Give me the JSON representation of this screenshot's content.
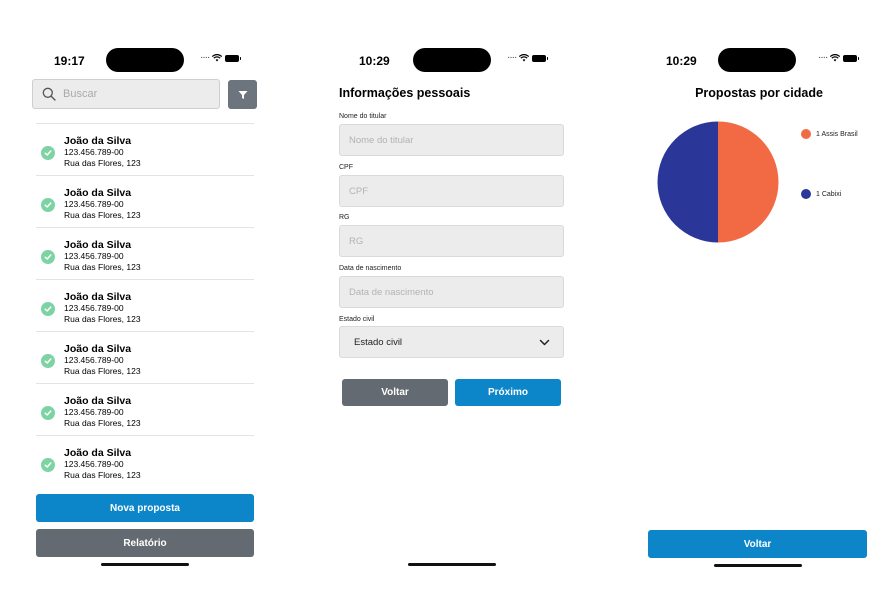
{
  "screens": {
    "list": {
      "time": "19:17",
      "search": {
        "placeholder": "Buscar"
      },
      "filter_icon": "filter-icon",
      "clients": [
        {
          "name": "João da Silva",
          "document": "123.456.789-00",
          "address": "Rua das Flores, 123"
        },
        {
          "name": "João da Silva",
          "document": "123.456.789-00",
          "address": "Rua das Flores, 123"
        },
        {
          "name": "João da Silva",
          "document": "123.456.789-00",
          "address": "Rua das Flores, 123"
        },
        {
          "name": "João da Silva",
          "document": "123.456.789-00",
          "address": "Rua das Flores, 123"
        },
        {
          "name": "João da Silva",
          "document": "123.456.789-00",
          "address": "Rua das Flores, 123"
        },
        {
          "name": "João da Silva",
          "document": "123.456.789-00",
          "address": "Rua das Flores, 123"
        },
        {
          "name": "João da Silva",
          "document": "123.456.789-00",
          "address": "Rua das Flores, 123"
        }
      ],
      "new_proposal_label": "Nova proposta",
      "report_label": "Relatório"
    },
    "form": {
      "time": "10:29",
      "title": "Informações pessoais",
      "fields": [
        {
          "label": "Nome do titular",
          "placeholder": "Nome do titular"
        },
        {
          "label": "CPF",
          "placeholder": "CPF"
        },
        {
          "label": "RG",
          "placeholder": "RG"
        },
        {
          "label": "Data de nascimento",
          "placeholder": "Data de nascimento"
        }
      ],
      "marital_status": {
        "label": "Estado civil",
        "value": "Estado civil"
      },
      "back_label": "Voltar",
      "next_label": "Próximo"
    },
    "chart": {
      "time": "10:29",
      "back_label": "Voltar"
    }
  },
  "chart_data": {
    "type": "pie",
    "title": "Propostas por cidade",
    "categories": [
      "Assis Brasil",
      "Cabixi"
    ],
    "values": [
      1,
      1
    ],
    "legend": [
      "1 Assis Brasil",
      "1 Cabixi"
    ],
    "colors": [
      "#f26a43",
      "#2a3698"
    ],
    "legend_position": "right"
  },
  "colors": {
    "primary": "#0c86c9",
    "secondary": "#646a71",
    "success": "#7ed3a4"
  }
}
